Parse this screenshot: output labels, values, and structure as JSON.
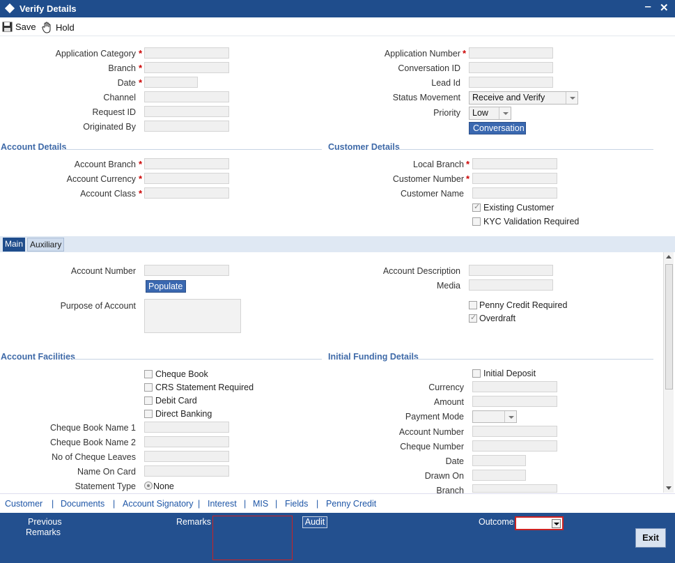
{
  "window": {
    "title": "Verify Details",
    "minimize": "‒",
    "close": "✕"
  },
  "toolbar": {
    "save": "Save",
    "hold": "Hold"
  },
  "header": {
    "application_category": "Application Category",
    "branch": "Branch",
    "date": "Date",
    "channel": "Channel",
    "request_id": "Request ID",
    "originated_by": "Originated By",
    "application_number": "Application Number",
    "conversation_id": "Conversation ID",
    "lead_id": "Lead Id",
    "status_movement": "Status Movement",
    "status_movement_value": "Receive and Verify",
    "priority": "Priority",
    "priority_value": "Low",
    "conversation_button": "Conversation"
  },
  "account_details": {
    "title": "Account Details",
    "account_branch": "Account Branch",
    "account_currency": "Account Currency",
    "account_class": "Account Class"
  },
  "customer_details": {
    "title": "Customer Details",
    "local_branch": "Local Branch",
    "customer_number": "Customer Number",
    "customer_name": "Customer Name",
    "existing_customer": "Existing Customer",
    "kyc_validation": "KYC Validation Required"
  },
  "tabs": {
    "main": "Main",
    "auxiliary": "Auxiliary"
  },
  "main_tab": {
    "account_number": "Account Number",
    "populate": "Populate",
    "purpose_of_account": "Purpose of Account",
    "account_description": "Account Description",
    "media": "Media",
    "penny_credit_required": "Penny Credit Required",
    "overdraft": "Overdraft"
  },
  "account_facilities": {
    "title": "Account Facilities",
    "cheque_book": "Cheque Book",
    "crs_statement": "CRS Statement Required",
    "debit_card": "Debit Card",
    "direct_banking": "Direct Banking",
    "cheque_book_name_1": "Cheque Book Name 1",
    "cheque_book_name_2": "Cheque Book Name 2",
    "no_of_cheque_leaves": "No of Cheque Leaves",
    "name_on_card": "Name On Card",
    "statement_type": "Statement Type",
    "statement_type_value": "None"
  },
  "initial_funding": {
    "title": "Initial Funding Details",
    "initial_deposit": "Initial Deposit",
    "currency": "Currency",
    "amount": "Amount",
    "payment_mode": "Payment Mode",
    "account_number": "Account Number",
    "cheque_number": "Cheque Number",
    "date": "Date",
    "drawn_on": "Drawn On",
    "branch": "Branch"
  },
  "links": [
    "Customer",
    "Documents",
    "Account Signatory",
    "Interest",
    "MIS",
    "Fields",
    "Penny Credit"
  ],
  "link_separator": "|",
  "footer": {
    "previous_remarks_1": "Previous",
    "previous_remarks_2": "Remarks",
    "remarks": "Remarks",
    "audit": "Audit",
    "outcome": "Outcome",
    "exit": "Exit"
  },
  "required_mark": "*"
}
